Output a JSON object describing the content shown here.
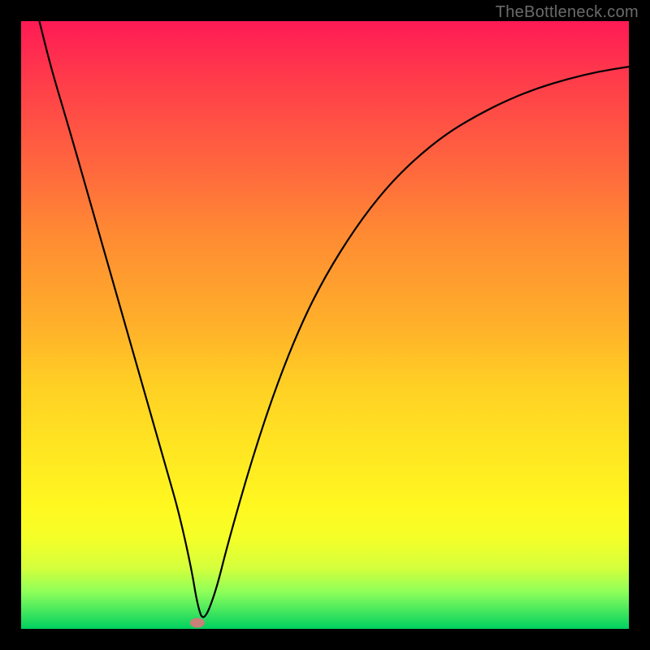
{
  "watermark": "TheBottleneck.com",
  "chart_data": {
    "type": "line",
    "title": "",
    "xlabel": "",
    "ylabel": "",
    "xlim": [
      0,
      100
    ],
    "ylim": [
      0,
      100
    ],
    "series": [
      {
        "name": "curve",
        "x": [
          3,
          5,
          8,
          12,
          16,
          20,
          24,
          26,
          28,
          29,
          30,
          32,
          34,
          38,
          42,
          46,
          50,
          55,
          60,
          65,
          70,
          75,
          80,
          85,
          90,
          95,
          100
        ],
        "values": [
          100,
          92,
          82,
          68,
          54,
          40,
          26,
          19,
          10,
          4,
          1,
          6,
          14,
          28,
          40,
          50,
          58,
          66,
          72.5,
          77.5,
          81.5,
          84.5,
          87,
          89,
          90.5,
          91.7,
          92.5
        ]
      }
    ],
    "marker": {
      "x": 29,
      "y": 1,
      "color": "#c88078"
    },
    "curve_color": "#000000",
    "background_gradient_stops": [
      {
        "pos": 0,
        "color": "#ff1a55"
      },
      {
        "pos": 10,
        "color": "#ff3d4a"
      },
      {
        "pos": 25,
        "color": "#ff6a3d"
      },
      {
        "pos": 35,
        "color": "#ff8a33"
      },
      {
        "pos": 50,
        "color": "#ffb02a"
      },
      {
        "pos": 60,
        "color": "#ffd024"
      },
      {
        "pos": 70,
        "color": "#ffe522"
      },
      {
        "pos": 80,
        "color": "#fff820"
      },
      {
        "pos": 85,
        "color": "#f5ff28"
      },
      {
        "pos": 90,
        "color": "#d4ff3c"
      },
      {
        "pos": 94,
        "color": "#8cff5a"
      },
      {
        "pos": 100,
        "color": "#00d060"
      }
    ]
  }
}
